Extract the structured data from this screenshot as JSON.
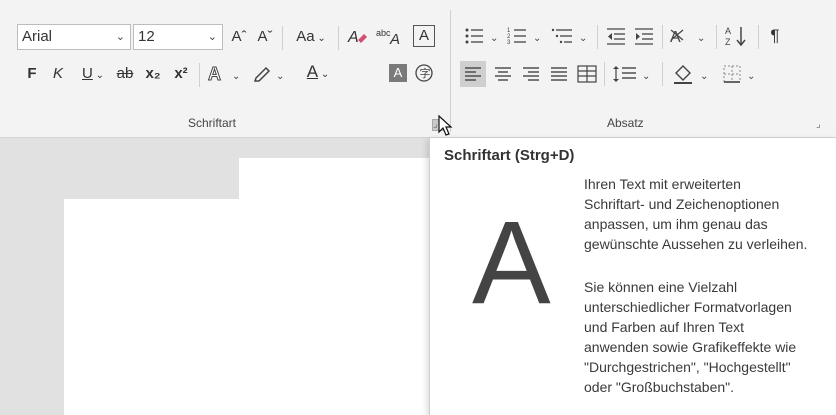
{
  "ribbon": {
    "font": {
      "family_value": "Arial",
      "size_value": "12",
      "grow_label": "Aˆ",
      "shrink_label": "Aˇ",
      "case_label": "Aa",
      "bold_label": "F",
      "italic_label": "K",
      "underline_label": "U",
      "strike_label": "ab",
      "subscript_label": "x₂",
      "superscript_label": "x²",
      "color_label": "A",
      "shade_label": "A",
      "group_label": "Schriftart"
    },
    "paragraph": {
      "group_label": "Absatz"
    }
  },
  "tooltip": {
    "title": "Schriftart (Strg+D)",
    "glyph": "A",
    "p1_lines": [
      "Ihren Text mit erweiterten",
      "Schriftart- und Zeichenoptionen",
      "anpassen, um ihm genau das",
      "gewünschte Aussehen zu verleihen."
    ],
    "p2_lines": [
      "Sie können eine Vielzahl",
      "unterschiedlicher Formatvorlagen",
      "und Farben auf Ihren Text",
      "anwenden sowie Grafikeffekte wie",
      "\"Durchgestrichen\", \"Hochgestellt\"",
      "oder \"Großbuchstaben\"."
    ]
  },
  "colors": {
    "ribbon_bg": "#f3f3f3",
    "doc_bg": "#e1e1e1",
    "page_bg": "#ffffff"
  }
}
